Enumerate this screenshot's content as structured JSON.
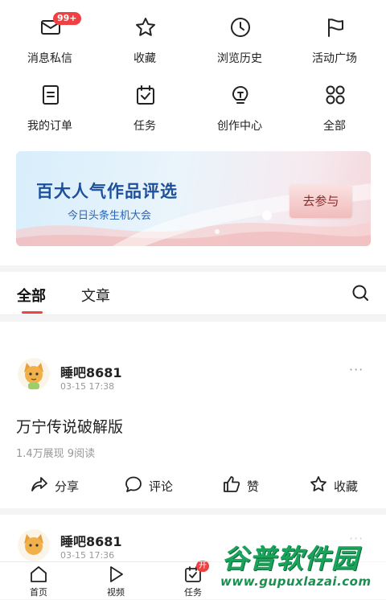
{
  "grid": {
    "items": [
      {
        "label": "消息私信",
        "icon": "message-icon",
        "badge": "99+"
      },
      {
        "label": "收藏",
        "icon": "star-icon"
      },
      {
        "label": "浏览历史",
        "icon": "clock-icon"
      },
      {
        "label": "活动广场",
        "icon": "flag-icon"
      },
      {
        "label": "我的订单",
        "icon": "order-icon"
      },
      {
        "label": "任务",
        "icon": "task-icon"
      },
      {
        "label": "创作中心",
        "icon": "bulb-icon"
      },
      {
        "label": "全部",
        "icon": "all-icon"
      }
    ]
  },
  "banner": {
    "title": "百大人气作品评选",
    "subtitle": "今日头条生机大会",
    "button": "去参与"
  },
  "tabs": {
    "active": "全部",
    "other": "文章"
  },
  "posts": [
    {
      "user": "睡吧8681",
      "time": "03-15 17:38",
      "title": "万宁传说破解版",
      "stats": "1.4万展现  9阅读",
      "more": "···",
      "actions": {
        "share": "分享",
        "comment": "评论",
        "like": "赞",
        "favorite": "收藏"
      }
    },
    {
      "user": "睡吧8681",
      "time": "03-15 17:36",
      "more": "···"
    }
  ],
  "nav": {
    "items": [
      {
        "label": "首页",
        "icon": "home-icon"
      },
      {
        "label": "视频",
        "icon": "video-icon"
      },
      {
        "label": "任务",
        "icon": "task-nav-icon",
        "badge": "开"
      }
    ]
  },
  "watermark": {
    "line1": "谷普软件园",
    "line2": "www.gupuxlazai.com"
  },
  "colors": {
    "accent": "#f04142",
    "banner_title": "#1e4f9a"
  }
}
